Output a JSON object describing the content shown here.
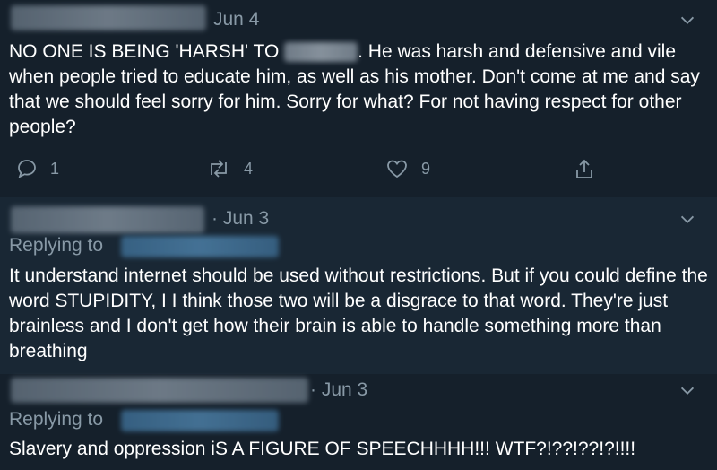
{
  "tweets": [
    {
      "date": "Jun 4",
      "text_part1": "NO ONE IS BEING 'HARSH' TO ",
      "text_part2": ". He was harsh and defensive and vile when people tried to educate him, as well as his mother. Don't come at me and say that we should feel sorry for him. Sorry for what? For not having respect for other people?",
      "actions": {
        "reply_count": "1",
        "retweet_count": "4",
        "like_count": "9"
      },
      "icons": [
        "reply-icon",
        "retweet-icon",
        "like-icon",
        "share-icon",
        "chevron-down-icon"
      ]
    },
    {
      "date": "· Jun 3",
      "replying_to": "Replying to",
      "text": "It understand internet should be used without restrictions. But if you could define the word STUPIDITY, I I think those two will be a disgrace to that word. They're just brainless and I don't get how their brain is able to handle something more than breathing"
    },
    {
      "date": "· Jun 3",
      "replying_to": "Replying to",
      "text": "Slavery and oppression iS A FIGURE OF SPEECHHHH!!! WTF?!??!??!?!!!!"
    }
  ],
  "colors": {
    "background": "#15202b",
    "alt_background": "#192734",
    "muted": "#8899a6",
    "text": "#ffffff"
  }
}
